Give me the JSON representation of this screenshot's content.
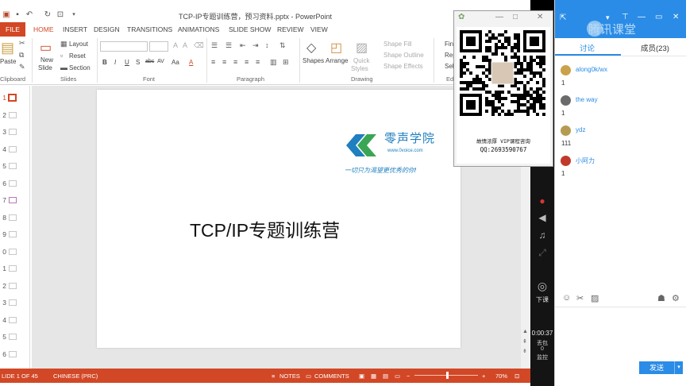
{
  "window": {
    "title": "TCP-IP专题训练营，预习资料.pptx - PowerPoint"
  },
  "tabs": [
    "FILE",
    "HOME",
    "INSERT",
    "DESIGN",
    "TRANSITIONS",
    "ANIMATIONS",
    "SLIDE SHOW",
    "REVIEW",
    "VIEW"
  ],
  "ribbon": {
    "clipboard": {
      "label": "Clipboard",
      "paste": "Paste"
    },
    "slides": {
      "label": "Slides",
      "new_slide": "New",
      "new_slide_2": "Slide",
      "layout": "Layout",
      "reset": "Reset",
      "section": "Section"
    },
    "font": {
      "label": "Font",
      "bold": "B",
      "italic": "I",
      "underline": "U",
      "shadow": "S",
      "strike": "abc",
      "spacing": "AV",
      "case": "Aa",
      "color": "A"
    },
    "paragraph": {
      "label": "Paragraph"
    },
    "drawing": {
      "label": "Drawing",
      "shapes": "Shapes",
      "arrange": "Arrange",
      "quick_styles": "Quick",
      "quick_styles_2": "Styles",
      "shape_fill": "Shape Fill",
      "shape_outline": "Shape Outline",
      "shape_effects": "Shape Effects"
    },
    "editing": {
      "label": "Edi",
      "find": "Fin",
      "replace": "Rep",
      "select": "Sel"
    }
  },
  "thumbnails": [
    "1",
    "2",
    "3",
    "4",
    "5",
    "6",
    "7",
    "8",
    "9",
    "0",
    "1",
    "2",
    "3",
    "4",
    "5",
    "6"
  ],
  "slide": {
    "title": "TCP/IP专题训练营",
    "logo_name": "零声学院",
    "logo_url": "www.0voice.com",
    "logo_slogan": "一切只为渴望更优秀的你!"
  },
  "statusbar": {
    "slide_info": "LIDE 1 OF 45",
    "language": "CHINESE (PRC)",
    "notes": "NOTES",
    "comments": "COMMENTS",
    "zoom": "70%"
  },
  "qr_window": {
    "caption": "故情浓厚 VIP课程咨询",
    "qq": "QQ:2693590767"
  },
  "side_tools": {
    "end_class": "下课",
    "time": "0:00:37",
    "stat_a": "丢包",
    "stat_b": "0",
    "stat_c": "监控"
  },
  "chat": {
    "brand": "腾讯课堂",
    "tab_discuss": "讨论",
    "tab_members": "成员(23)",
    "messages": [
      {
        "user": "along0k/wx",
        "text": "1",
        "avatar_color": "#c9a24a"
      },
      {
        "user": "the way",
        "text": "1",
        "avatar_color": "#6b6b6b"
      },
      {
        "user": "ydz",
        "text": "111",
        "avatar_color": "#b59b52"
      },
      {
        "user": "小阿力",
        "text": "1",
        "avatar_color": "#c0392b"
      }
    ],
    "send": "发送"
  },
  "colors": {
    "ppt_accent": "#d24726",
    "tencent_blue": "#2a8ce6"
  }
}
